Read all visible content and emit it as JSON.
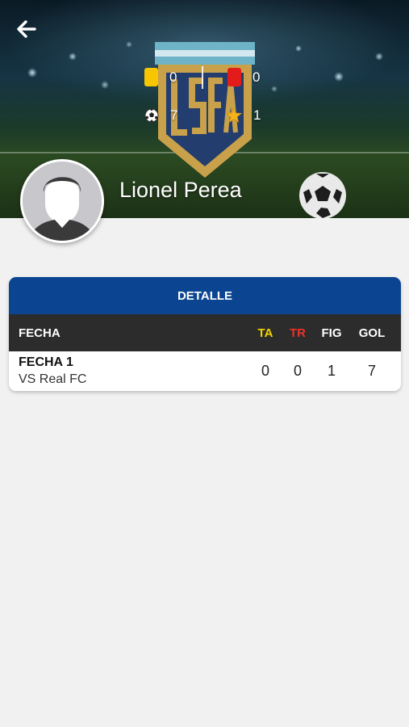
{
  "header": {
    "player_name": "Lionel Perea",
    "back_icon": "arrow-left-icon"
  },
  "stats": {
    "yellow_cards": "0",
    "red_cards": "0",
    "goals": "7",
    "figure": "1"
  },
  "detail": {
    "title": "DETALLE",
    "columns": {
      "fecha": "FECHA",
      "ta": "TA",
      "tr": "TR",
      "fig": "FIG",
      "gol": "GOL"
    },
    "rows": [
      {
        "fecha": "FECHA 1",
        "opponent": "VS Real FC",
        "ta": "0",
        "tr": "0",
        "fig": "1",
        "gol": "7"
      }
    ]
  },
  "colors": {
    "primary": "#0b4591",
    "header_row": "#2c2c2c",
    "yellow_card": "#f7c600",
    "red_card": "#e31b1b",
    "crest_gold": "#c9a14a",
    "crest_blue": "#233e6e"
  }
}
